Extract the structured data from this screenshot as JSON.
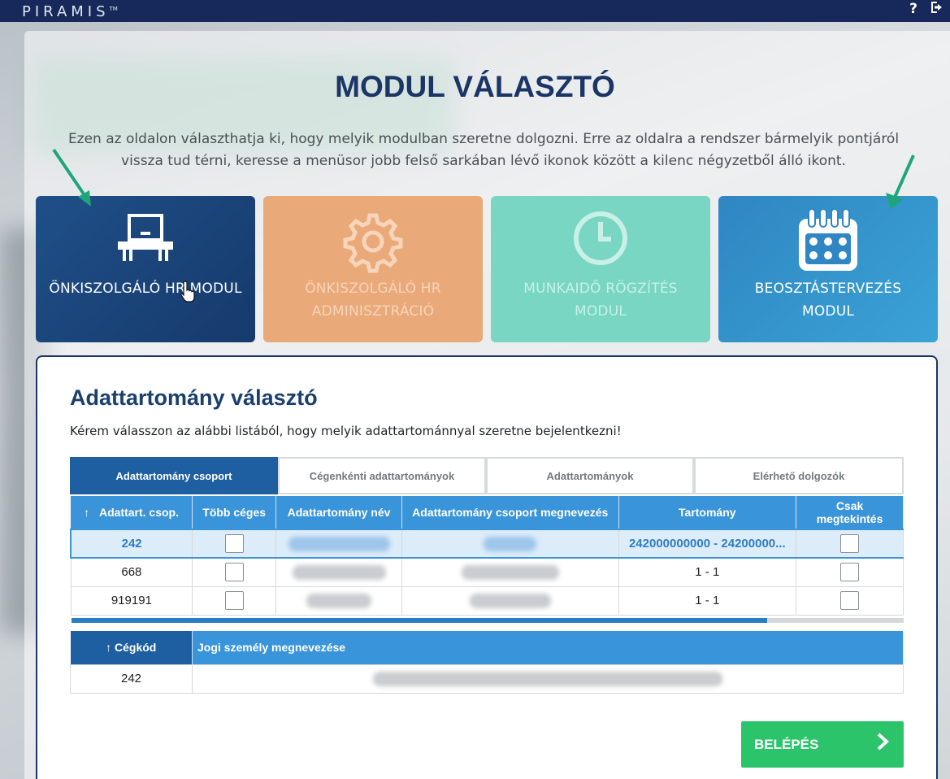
{
  "header": {
    "logo": "PIRAMIS",
    "logo_tm": "TM"
  },
  "page": {
    "title": "MODUL VÁLASZTÓ",
    "intro": "Ezen az oldalon választhatja ki, hogy melyik modulban szeretne dolgozni. Erre az oldalra a rendszer bármelyik pontjáról vissza tud térni, keresse a menüsor jobb felső sarkában lévő ikonok között a kilenc négyzetből álló ikont."
  },
  "modules": [
    {
      "label": "ÖNKISZOLGÁLÓ HR MODUL",
      "icon": "desk-computer-icon",
      "color": "#1f4f88",
      "active": true
    },
    {
      "label": "ÖNKISZOLGÁLÓ HR ADMINISZTRÁCIÓ",
      "icon": "gear-icon",
      "color": "#eaa978",
      "active": false
    },
    {
      "label": "MUNKAIDŐ RÖGZÍTÉS MODUL",
      "icon": "clock-icon",
      "color": "#79d6c3",
      "active": false
    },
    {
      "label": "BEOSZTÁSTERVEZÉS MODUL",
      "icon": "calendar-icon",
      "color": "#3aa2d6",
      "active": true
    }
  ],
  "domain": {
    "title": "Adattartomány választó",
    "description": "Kérem válasszon az alábbi listából, hogy melyik adattartománnyal szeretne bejelentkezni!",
    "tabs": [
      "Adattartomány csoport",
      "Cégenkénti adattartományok",
      "Adattartományok",
      "Elérhető dolgozók"
    ],
    "columns": [
      "Adattart. csop.",
      "Több céges",
      "Adattartomány név",
      "Adattartomány csoport megnevezés",
      "Tartomány",
      "Csak megtekintés"
    ],
    "sort_indicator": "↑",
    "rows": [
      {
        "code": "242",
        "range": "242000000000 - 24200000..."
      },
      {
        "code": "668",
        "range": "1 - 1"
      },
      {
        "code": "919191",
        "range": "1 - 1"
      }
    ],
    "sub_columns": [
      "Cégkód",
      "Jogi személy megnevezése"
    ],
    "sub_rows": [
      {
        "code": "242"
      }
    ],
    "login_button": "BELÉPÉS"
  }
}
